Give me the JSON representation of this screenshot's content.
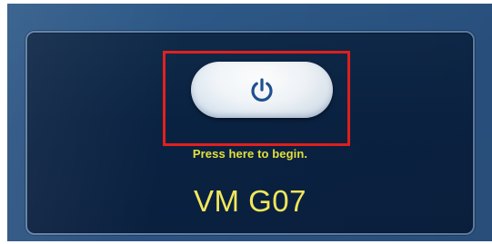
{
  "screen": {
    "power_button": {
      "icon": "power-icon",
      "icon_color": "#1f5190"
    },
    "prompt_text": "Press here to begin.",
    "station_name": "VM G07",
    "colors": {
      "highlight": "#e3201c",
      "text_yellow": "#e6e23a",
      "panel_bg": "#0a2242",
      "surround_bg": "#2a5282"
    }
  }
}
